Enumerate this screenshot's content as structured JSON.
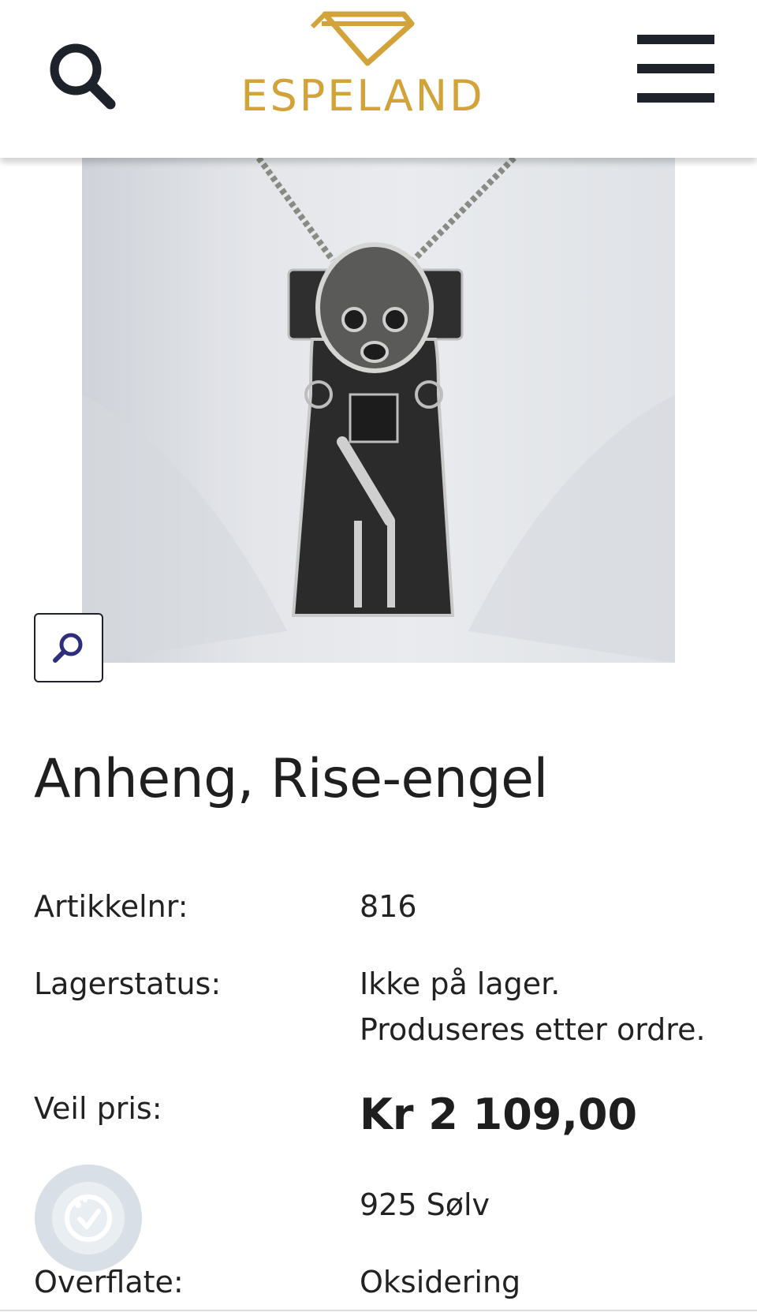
{
  "header": {
    "brand_name": "ESPELAND",
    "search_icon": "search-icon",
    "menu_icon": "hamburger-menu-icon",
    "brand_color": "#d1a338"
  },
  "product": {
    "image_description_icon": "product-photo",
    "zoom_icon": "zoom-icon",
    "title": "Anheng, Rise-engel",
    "specs": [
      {
        "label": "Artikkelnr:",
        "value": "816"
      },
      {
        "label": "Lagerstatus:",
        "value": "Ikke på lager. Produseres etter ordre."
      },
      {
        "label": "Veil pris:",
        "value": "Kr 2 109,00"
      },
      {
        "label": "",
        "value": "925 Sølv"
      },
      {
        "label": "Overflate:",
        "value": "Oksidering"
      }
    ]
  },
  "cookie_badge": {
    "icon": "cookie-consent-icon"
  }
}
